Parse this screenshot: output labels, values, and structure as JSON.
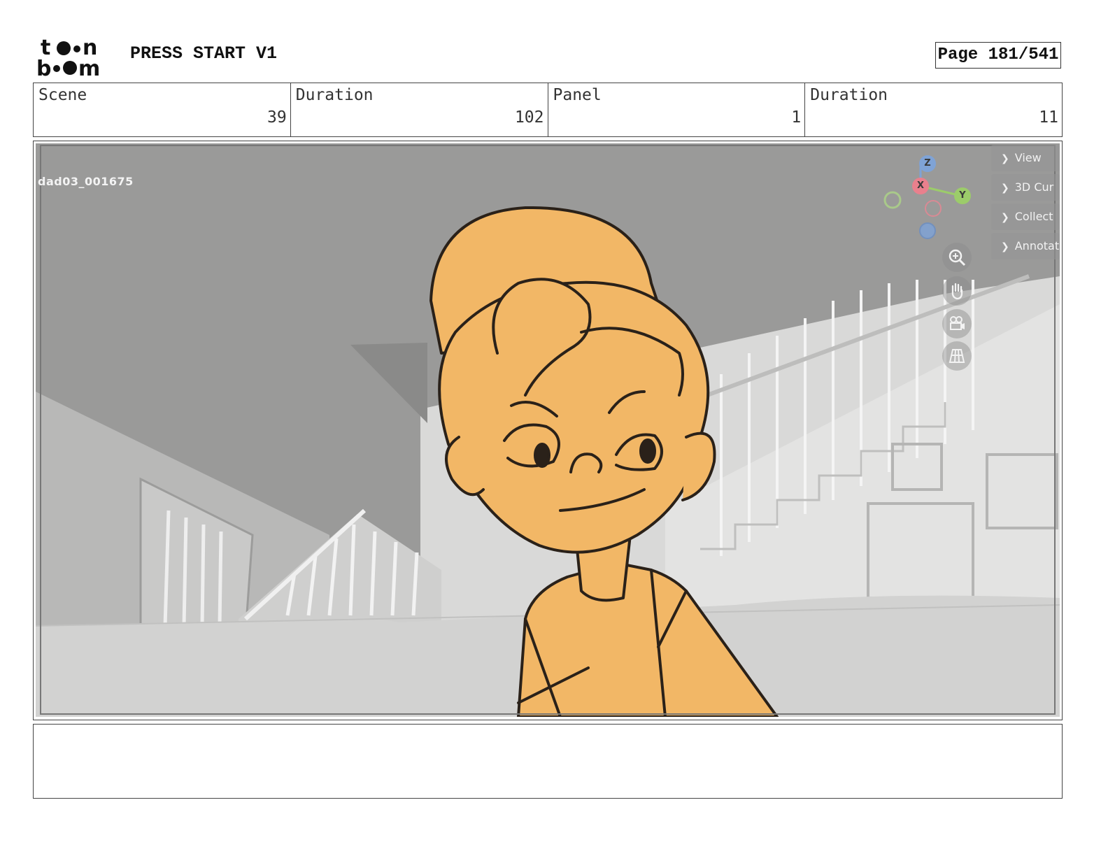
{
  "header": {
    "project_title": "PRESS START V1",
    "page_label": "Page 181/541",
    "logo_text": "toon boom"
  },
  "info": {
    "scene_label": "Scene",
    "scene_value": "39",
    "scene_duration_label": "Duration",
    "scene_duration_value": "102",
    "panel_label": "Panel",
    "panel_value": "1",
    "panel_duration_label": "Duration",
    "panel_duration_value": "11"
  },
  "panel": {
    "frame_id": "dad03_001675",
    "side_panel": [
      "View",
      "3D Cur",
      "Collect",
      "Annotat"
    ],
    "gizmo": {
      "z": "Z",
      "x": "X",
      "y": "Y"
    },
    "tools": [
      "zoom-icon",
      "hand-icon",
      "camera-icon",
      "grid-icon"
    ]
  },
  "notes": {
    "text": ""
  },
  "colors": {
    "character_fill": "#F2B766",
    "line_art": "#2a2119",
    "background_grey": "#9a9a99",
    "wall_light": "#d9d9d8"
  }
}
